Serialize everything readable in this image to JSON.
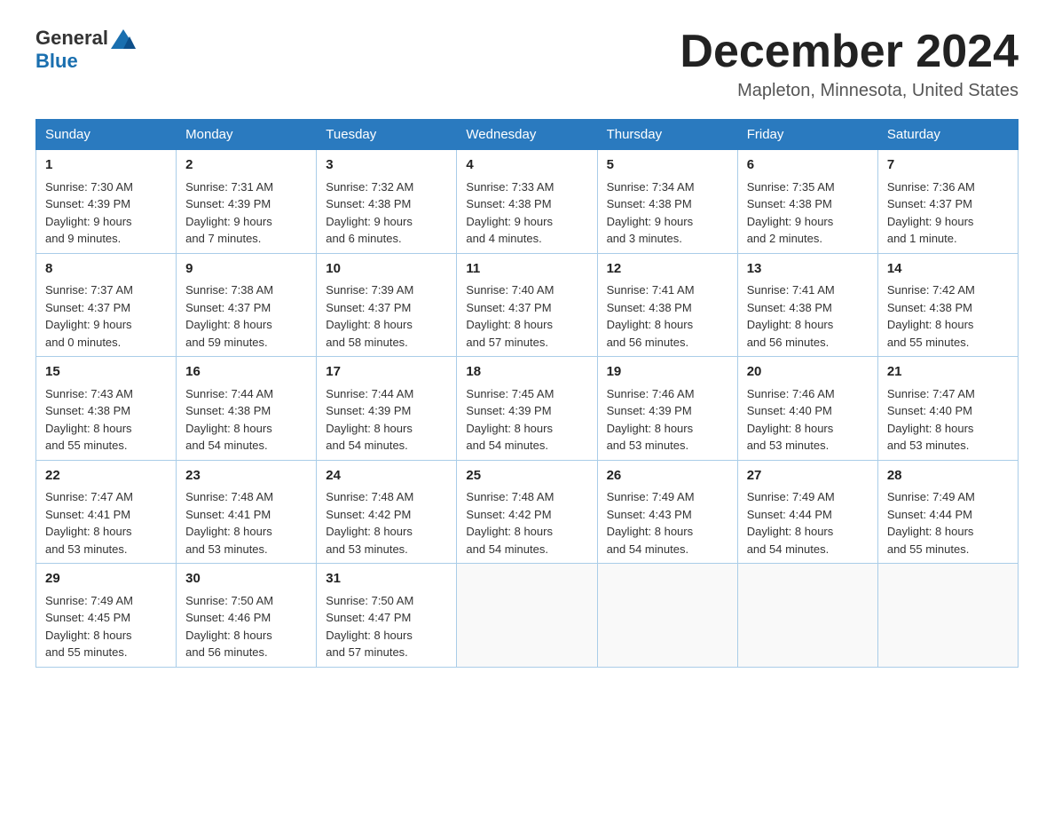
{
  "header": {
    "logo": {
      "general": "General",
      "blue": "Blue"
    },
    "month_title": "December 2024",
    "location": "Mapleton, Minnesota, United States"
  },
  "weekdays": [
    "Sunday",
    "Monday",
    "Tuesday",
    "Wednesday",
    "Thursday",
    "Friday",
    "Saturday"
  ],
  "weeks": [
    [
      {
        "day": "1",
        "sunrise": "7:30 AM",
        "sunset": "4:39 PM",
        "daylight": "9 hours and 9 minutes."
      },
      {
        "day": "2",
        "sunrise": "7:31 AM",
        "sunset": "4:39 PM",
        "daylight": "9 hours and 7 minutes."
      },
      {
        "day": "3",
        "sunrise": "7:32 AM",
        "sunset": "4:38 PM",
        "daylight": "9 hours and 6 minutes."
      },
      {
        "day": "4",
        "sunrise": "7:33 AM",
        "sunset": "4:38 PM",
        "daylight": "9 hours and 4 minutes."
      },
      {
        "day": "5",
        "sunrise": "7:34 AM",
        "sunset": "4:38 PM",
        "daylight": "9 hours and 3 minutes."
      },
      {
        "day": "6",
        "sunrise": "7:35 AM",
        "sunset": "4:38 PM",
        "daylight": "9 hours and 2 minutes."
      },
      {
        "day": "7",
        "sunrise": "7:36 AM",
        "sunset": "4:37 PM",
        "daylight": "9 hours and 1 minute."
      }
    ],
    [
      {
        "day": "8",
        "sunrise": "7:37 AM",
        "sunset": "4:37 PM",
        "daylight": "9 hours and 0 minutes."
      },
      {
        "day": "9",
        "sunrise": "7:38 AM",
        "sunset": "4:37 PM",
        "daylight": "8 hours and 59 minutes."
      },
      {
        "day": "10",
        "sunrise": "7:39 AM",
        "sunset": "4:37 PM",
        "daylight": "8 hours and 58 minutes."
      },
      {
        "day": "11",
        "sunrise": "7:40 AM",
        "sunset": "4:37 PM",
        "daylight": "8 hours and 57 minutes."
      },
      {
        "day": "12",
        "sunrise": "7:41 AM",
        "sunset": "4:38 PM",
        "daylight": "8 hours and 56 minutes."
      },
      {
        "day": "13",
        "sunrise": "7:41 AM",
        "sunset": "4:38 PM",
        "daylight": "8 hours and 56 minutes."
      },
      {
        "day": "14",
        "sunrise": "7:42 AM",
        "sunset": "4:38 PM",
        "daylight": "8 hours and 55 minutes."
      }
    ],
    [
      {
        "day": "15",
        "sunrise": "7:43 AM",
        "sunset": "4:38 PM",
        "daylight": "8 hours and 55 minutes."
      },
      {
        "day": "16",
        "sunrise": "7:44 AM",
        "sunset": "4:38 PM",
        "daylight": "8 hours and 54 minutes."
      },
      {
        "day": "17",
        "sunrise": "7:44 AM",
        "sunset": "4:39 PM",
        "daylight": "8 hours and 54 minutes."
      },
      {
        "day": "18",
        "sunrise": "7:45 AM",
        "sunset": "4:39 PM",
        "daylight": "8 hours and 54 minutes."
      },
      {
        "day": "19",
        "sunrise": "7:46 AM",
        "sunset": "4:39 PM",
        "daylight": "8 hours and 53 minutes."
      },
      {
        "day": "20",
        "sunrise": "7:46 AM",
        "sunset": "4:40 PM",
        "daylight": "8 hours and 53 minutes."
      },
      {
        "day": "21",
        "sunrise": "7:47 AM",
        "sunset": "4:40 PM",
        "daylight": "8 hours and 53 minutes."
      }
    ],
    [
      {
        "day": "22",
        "sunrise": "7:47 AM",
        "sunset": "4:41 PM",
        "daylight": "8 hours and 53 minutes."
      },
      {
        "day": "23",
        "sunrise": "7:48 AM",
        "sunset": "4:41 PM",
        "daylight": "8 hours and 53 minutes."
      },
      {
        "day": "24",
        "sunrise": "7:48 AM",
        "sunset": "4:42 PM",
        "daylight": "8 hours and 53 minutes."
      },
      {
        "day": "25",
        "sunrise": "7:48 AM",
        "sunset": "4:42 PM",
        "daylight": "8 hours and 54 minutes."
      },
      {
        "day": "26",
        "sunrise": "7:49 AM",
        "sunset": "4:43 PM",
        "daylight": "8 hours and 54 minutes."
      },
      {
        "day": "27",
        "sunrise": "7:49 AM",
        "sunset": "4:44 PM",
        "daylight": "8 hours and 54 minutes."
      },
      {
        "day": "28",
        "sunrise": "7:49 AM",
        "sunset": "4:44 PM",
        "daylight": "8 hours and 55 minutes."
      }
    ],
    [
      {
        "day": "29",
        "sunrise": "7:49 AM",
        "sunset": "4:45 PM",
        "daylight": "8 hours and 55 minutes."
      },
      {
        "day": "30",
        "sunrise": "7:50 AM",
        "sunset": "4:46 PM",
        "daylight": "8 hours and 56 minutes."
      },
      {
        "day": "31",
        "sunrise": "7:50 AM",
        "sunset": "4:47 PM",
        "daylight": "8 hours and 57 minutes."
      },
      null,
      null,
      null,
      null
    ]
  ],
  "labels": {
    "sunrise": "Sunrise:",
    "sunset": "Sunset:",
    "daylight": "Daylight:"
  }
}
